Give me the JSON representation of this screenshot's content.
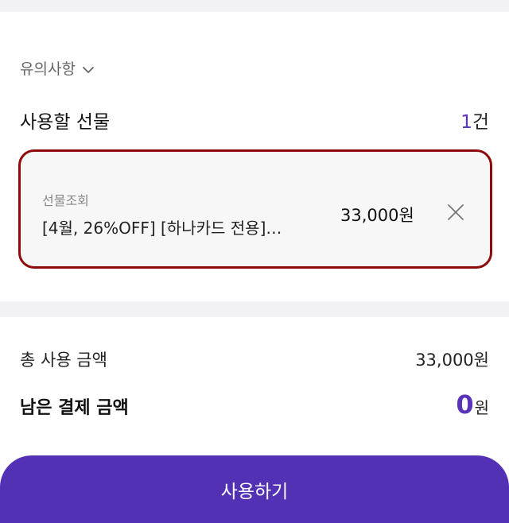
{
  "notice": {
    "label": "유의사항",
    "icon": "chevron-down-icon"
  },
  "gifts": {
    "label": "사용할 선물",
    "count_value": "1",
    "count_unit": "건",
    "items": [
      {
        "type": "선물조회",
        "name": "[4월, 26%OFF] [하나카드 전용]…",
        "price": "33,000원",
        "remove_icon": "close-icon"
      }
    ]
  },
  "summary": {
    "total_label": "총 사용 금액",
    "total_value": "33,000원",
    "remaining_label": "남은 결제 금액",
    "remaining_amount": "0",
    "remaining_unit": "원"
  },
  "action": {
    "use_label": "사용하기"
  },
  "colors": {
    "accent": "#5331b4",
    "highlight_border": "#8f0a0a"
  }
}
